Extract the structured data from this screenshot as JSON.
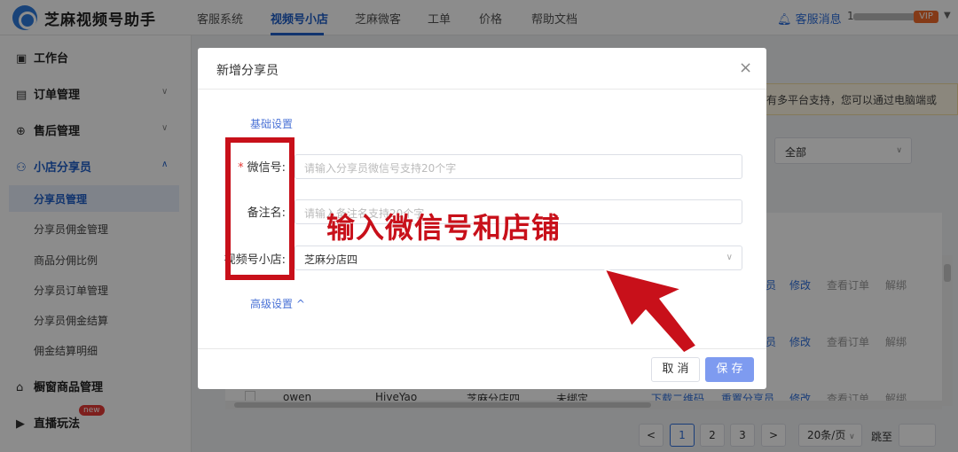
{
  "app": {
    "name": "芝麻视频号助手"
  },
  "nav": {
    "items": [
      "客服系统",
      "视频号小店",
      "芝麻微客",
      "工单",
      "价格",
      "帮助文档"
    ],
    "active": "视频号小店",
    "message": "客服消息",
    "account_prefix": "1",
    "vip_label": "VIP"
  },
  "sidebar": {
    "workbench": "工作台",
    "orders": "订单管理",
    "aftersale": "售后管理",
    "sharer": "小店分享员",
    "sharer_items": [
      "分享员管理",
      "分享员佣金管理",
      "商品分佣比例",
      "分享员订单管理",
      "分享员佣金结算",
      "佣金结算明细"
    ],
    "window_goods": "橱窗商品管理",
    "live": "直播玩法",
    "new_badge": "new"
  },
  "background": {
    "notice": "有多平台支持，您可以通过电脑端或",
    "select_value": "全部",
    "row_ops": [
      "修改",
      "查看订单",
      "解绑"
    ],
    "row_ops_partial": "员",
    "last_row": {
      "name": "owen",
      "nick": "HiveYao",
      "shop": "芝麻分店四",
      "status": "未绑定",
      "qrcode": "下载二维码",
      "reset": "重置分享员",
      "edit": "修改",
      "view": "查看订单",
      "unbind": "解绑"
    },
    "pager": {
      "prev": "<",
      "pages": [
        "1",
        "2",
        "3"
      ],
      "next": ">",
      "size": "20条/页",
      "jump": "跳至"
    }
  },
  "modal": {
    "title": "新增分享员",
    "close": "×",
    "basic_section": "基础设置",
    "wechat_label": "微信号:",
    "wechat_placeholder": "请输入分享员微信号支持20个字",
    "remark_label": "备注名:",
    "remark_placeholder": "请输入备注名支持20个字",
    "shop_label": "视频号小店:",
    "shop_value": "芝麻分店四",
    "advanced_section": "高级设置 ^",
    "cancel": "取 消",
    "save": "保 存"
  },
  "annotation": {
    "text": "输入微信号和店铺",
    "color": "#c8101a"
  },
  "colors": {
    "accent": "#1f5fc8",
    "save_button": "#7e9bf0",
    "annotation": "#c8101a"
  }
}
